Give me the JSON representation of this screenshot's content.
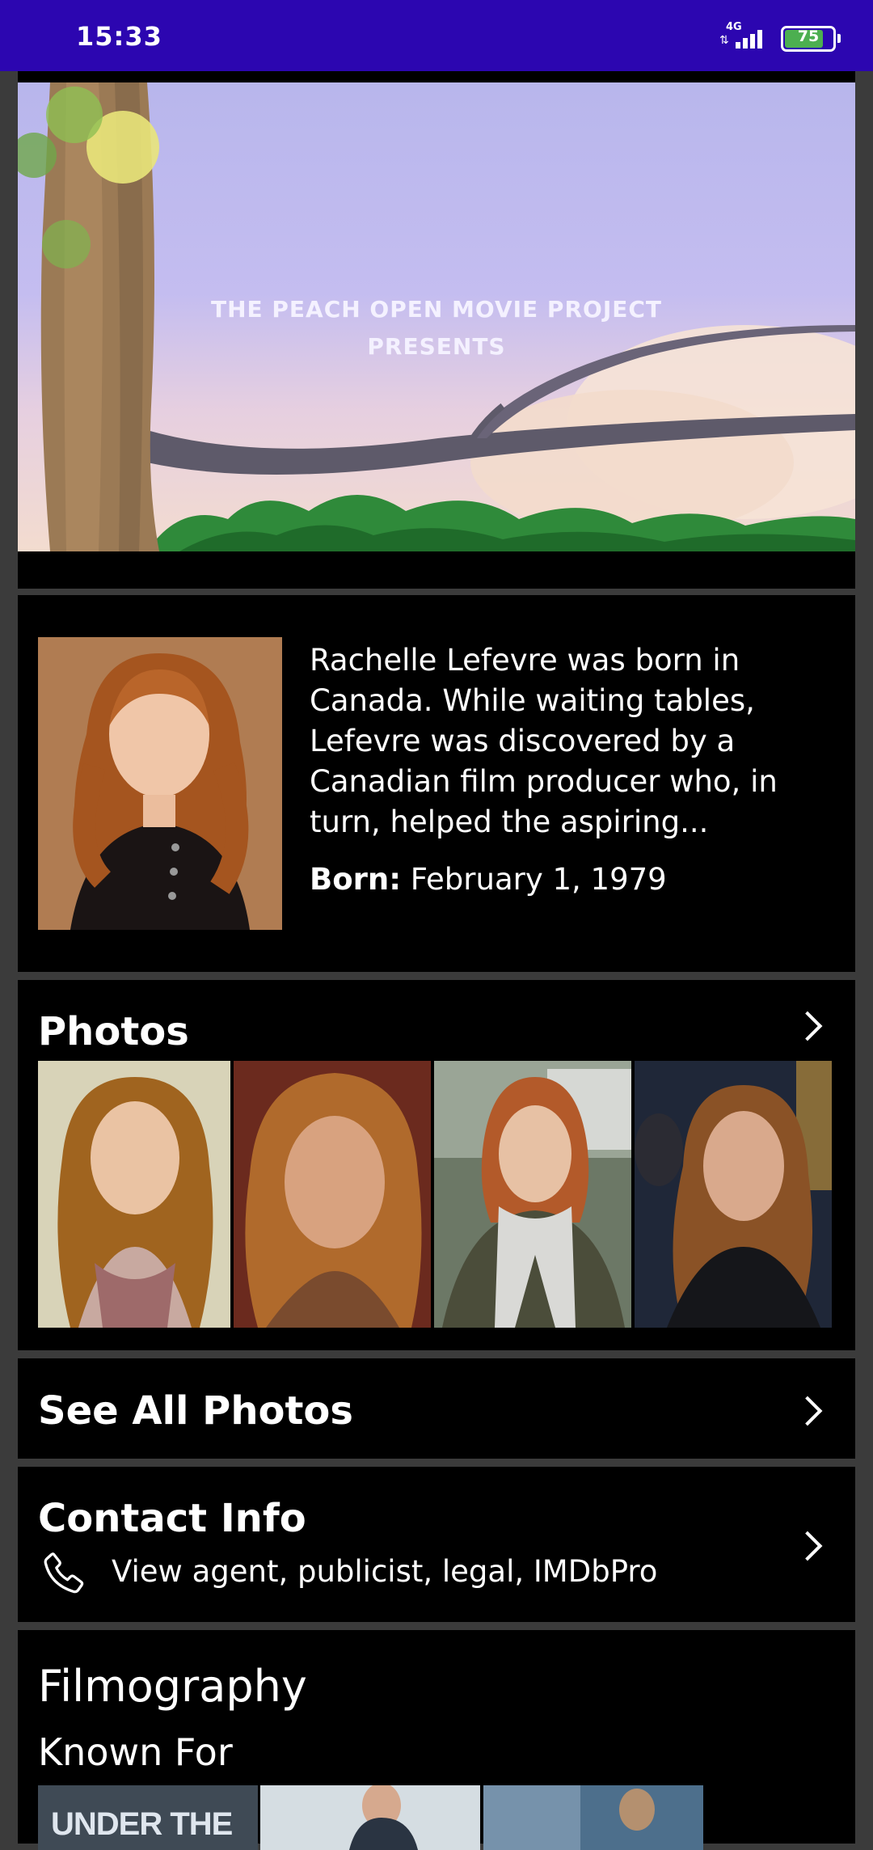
{
  "status_bar": {
    "time": "15:33",
    "network": "4G",
    "battery": "75"
  },
  "video": {
    "caption_line1": "THE PEACH OPEN MOVIE PROJECT",
    "caption_line2": "PRESENTS"
  },
  "bio": {
    "text": "Rachelle Lefevre was born in Canada. While waiting tables, Lefevre was discovered by a Canadian film producer who, in turn, helped the aspiring...",
    "born_label": "Born:",
    "born_value": "February 1, 1979"
  },
  "photos": {
    "title": "Photos"
  },
  "see_all": {
    "label": "See All Photos"
  },
  "contact": {
    "title": "Contact Info",
    "subtitle": "View agent, publicist, legal, IMDbPro"
  },
  "filmography": {
    "title": "Filmography",
    "known_for": "Known For",
    "poster1_text": "UNDER THE"
  },
  "colors": {
    "status_bar": "#2c06b0",
    "card_bg": "#000000",
    "page_bg": "#3b3b3b"
  }
}
